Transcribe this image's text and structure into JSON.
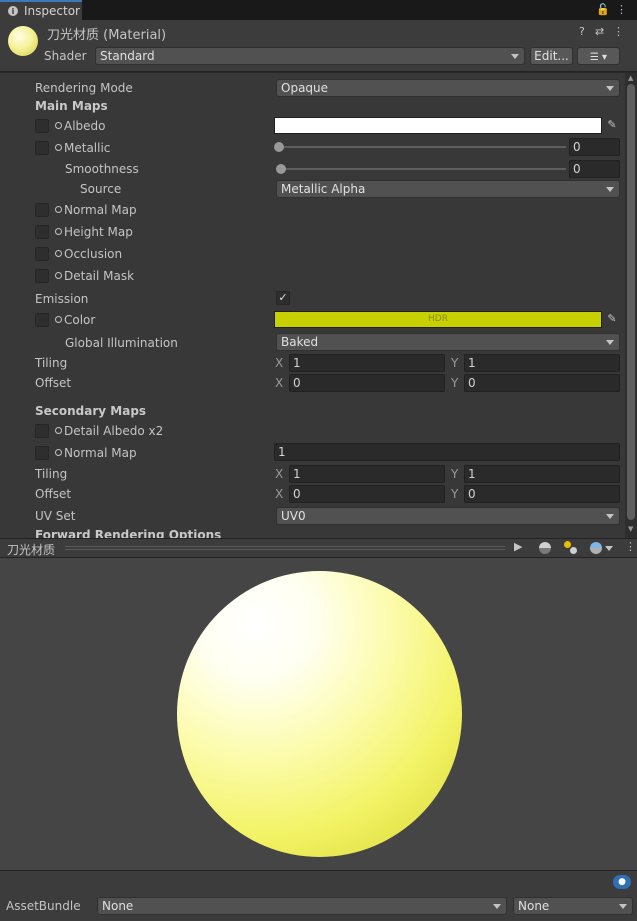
{
  "tab": {
    "title": "Inspector",
    "icon": "info-icon"
  },
  "header": {
    "material_name": "刀光材质 (Material)",
    "shader_label": "Shader",
    "shader_value": "Standard",
    "edit_label": "Edit...",
    "icons": [
      "help-icon",
      "preset-icon",
      "more-icon"
    ]
  },
  "rendering_mode": {
    "label": "Rendering Mode",
    "value": "Opaque"
  },
  "main_maps": {
    "heading": "Main Maps",
    "albedo": {
      "label": "Albedo",
      "color": "#ffffff"
    },
    "metallic": {
      "label": "Metallic",
      "value": "0",
      "slider": 0
    },
    "smoothness": {
      "label": "Smoothness",
      "value": "0",
      "slider": 0
    },
    "source": {
      "label": "Source",
      "value": "Metallic Alpha"
    },
    "normal_map": {
      "label": "Normal Map"
    },
    "height_map": {
      "label": "Height Map"
    },
    "occlusion": {
      "label": "Occlusion"
    },
    "detail_mask": {
      "label": "Detail Mask"
    },
    "emission": {
      "label": "Emission",
      "checked": true
    },
    "color": {
      "label": "Color",
      "hdr_text": "HDR",
      "color": "#c8d000"
    },
    "global_illumination": {
      "label": "Global Illumination",
      "value": "Baked"
    },
    "tiling": {
      "label": "Tiling",
      "x_label": "X",
      "x": "1",
      "y_label": "Y",
      "y": "1"
    },
    "offset": {
      "label": "Offset",
      "x_label": "X",
      "x": "0",
      "y_label": "Y",
      "y": "0"
    }
  },
  "secondary_maps": {
    "heading": "Secondary Maps",
    "detail_albedo": {
      "label": "Detail Albedo x2"
    },
    "normal_map": {
      "label": "Normal Map",
      "value": "1"
    },
    "tiling": {
      "label": "Tiling",
      "x_label": "X",
      "x": "1",
      "y_label": "Y",
      "y": "1"
    },
    "offset": {
      "label": "Offset",
      "x_label": "X",
      "x": "0",
      "y_label": "Y",
      "y": "0"
    },
    "uv_set": {
      "label": "UV Set",
      "value": "UV0"
    }
  },
  "forward_options": {
    "heading": "Forward Rendering Options"
  },
  "preview": {
    "title": "刀光材质",
    "icons": [
      "play-icon",
      "sphere-icon",
      "lights-icon",
      "sky-sphere-icon",
      "more-icon"
    ]
  },
  "asset_bundle": {
    "label": "AssetBundle",
    "name_value": "None",
    "variant_value": "None"
  }
}
